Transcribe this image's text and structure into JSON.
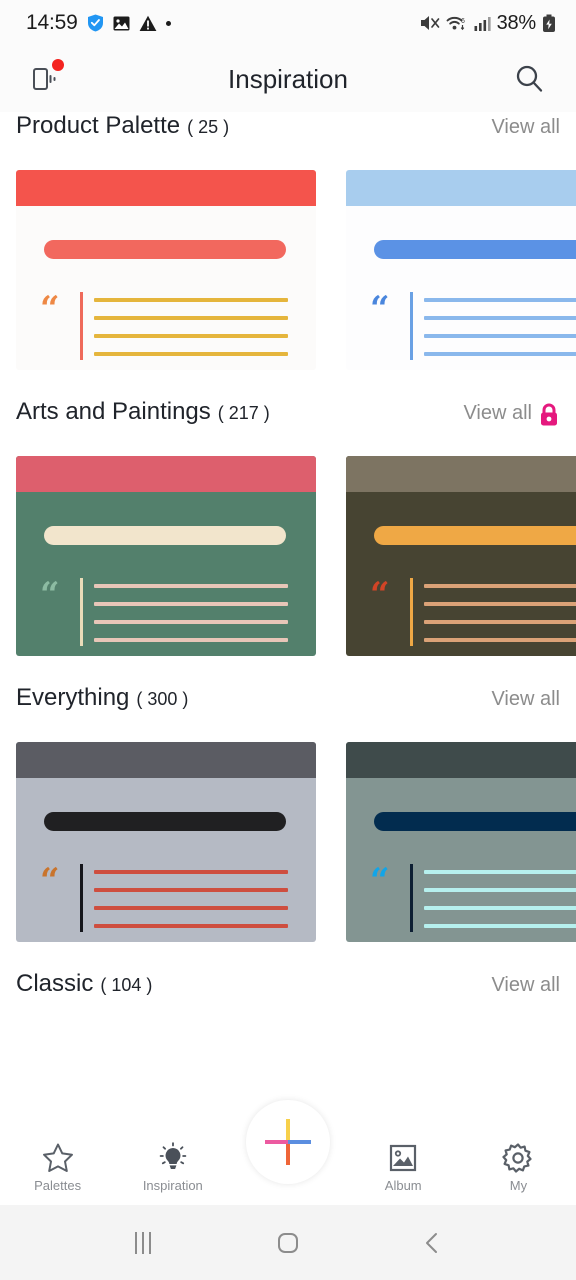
{
  "status_bar": {
    "time": "14:59",
    "battery_percent": "38%",
    "left_icons": [
      "shield-check-icon",
      "photo-icon",
      "warning-triangle-icon",
      "dot-icon"
    ],
    "right_icons": [
      "mute-icon",
      "wifi-6-icon",
      "signal-bars-icon",
      "battery-charging-icon"
    ]
  },
  "app_bar": {
    "title": "Inspiration",
    "left_icon": "vibrate-phone-icon",
    "has_notification_badge": true,
    "right_icon": "search-icon"
  },
  "sections": [
    {
      "title": "Product Palette",
      "count": "( 25 )",
      "view_all": "View all",
      "locked": false,
      "cards": [
        {
          "name": "red-gold-palette-card",
          "bg": "#fcfbfa",
          "header": "#f4544c",
          "bar": "#f2685e",
          "quote": "#ee8844",
          "divider": "#ef6a5a",
          "line": "#e5b53c"
        },
        {
          "name": "blue-palette-card",
          "bg": "#fdfdfe",
          "header": "#a8cdee",
          "bar": "#5b92e5",
          "quote": "#4a86dd",
          "divider": "#6aa1e4",
          "line": "#8ab8ec"
        }
      ]
    },
    {
      "title": "Arts and Paintings",
      "count": "( 217 )",
      "view_all": "View all",
      "locked": true,
      "lock_color": "#e5197e",
      "cards": [
        {
          "name": "green-cream-palette-card",
          "bg": "#53806c",
          "header": "#dd5f6d",
          "bar": "#f2e5cc",
          "quote": "#8cbba2",
          "divider": "#eadcb9",
          "line": "#e8c6b8"
        },
        {
          "name": "olive-orange-palette-card",
          "bg": "#474432",
          "header": "#7d7462",
          "bar": "#efa845",
          "quote": "#d14426",
          "divider": "#efa845",
          "line": "#dba277"
        }
      ]
    },
    {
      "title": "Everything",
      "count": "( 300 )",
      "view_all": "View all",
      "locked": false,
      "cards": [
        {
          "name": "grey-red-palette-card",
          "bg": "#b5bac4",
          "header": "#5b5c63",
          "bar": "#202022",
          "quote": "#c9742c",
          "divider": "#15161c",
          "line": "#ce4e3f"
        },
        {
          "name": "teal-cyan-palette-card",
          "bg": "#839592",
          "header": "#3f4b4b",
          "bar": "#022c4f",
          "quote": "#12a5e8",
          "divider": "#0d1f33",
          "line": "#b6f0ee"
        }
      ]
    },
    {
      "title": "Classic",
      "count": "( 104 )",
      "view_all": "View all",
      "locked": false,
      "cards": []
    }
  ],
  "bottom_nav": {
    "items": [
      {
        "label": "Palettes",
        "icon": "star-outline-icon",
        "active": false
      },
      {
        "label": "Inspiration",
        "icon": "lightbulb-filled-icon",
        "active": true
      },
      {
        "label": "Album",
        "icon": "image-icon",
        "active": false
      },
      {
        "label": "My",
        "icon": "gear-icon",
        "active": false
      }
    ],
    "fab": {
      "icon": "plus-icon",
      "colors": {
        "top": "#f7d04a",
        "left": "#ec5aa0",
        "right": "#5b8ee0",
        "bottom": "#ef6538"
      }
    }
  },
  "android_nav": {
    "recents": "recents-icon",
    "home": "home-icon",
    "back": "back-icon"
  }
}
